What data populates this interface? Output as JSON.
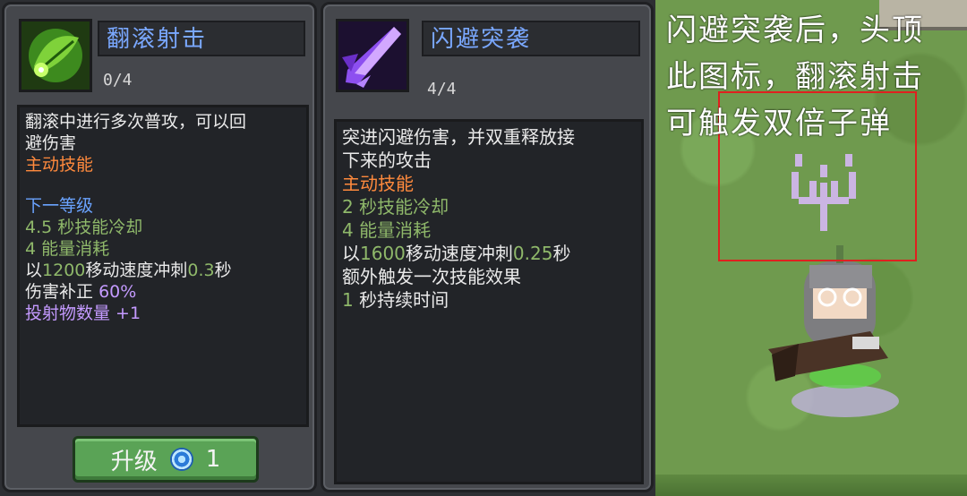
{
  "skill_1": {
    "name": "翻滚射击",
    "level": "0/4",
    "icon": "leaf-skill-icon",
    "desc_lines": [
      "翻滚中进行多次普攻，可以回",
      "避伤害"
    ],
    "type": "主动技能",
    "next_level_header": "下一等级",
    "cooldown": "4.5 秒技能冷却",
    "energy": "4 能量消耗",
    "dash_prefix": "以",
    "dash_speed": "1200",
    "dash_mid": "移动速度冲刺",
    "dash_time": "0.3",
    "dash_suffix": "秒",
    "damage_fix_label": "伤害补正",
    "damage_fix_value": "60%",
    "projectile": "投射物数量 +1",
    "upgrade_label": "升级",
    "upgrade_cost": "1"
  },
  "skill_2": {
    "name": "闪避突袭",
    "level": "4/4",
    "icon": "purple-arrow-skill-icon",
    "desc_lines": [
      "突进闪避伤害，并双重释放接",
      "下来的攻击"
    ],
    "type": "主动技能",
    "cooldown": "2 秒技能冷却",
    "energy": "4 能量消耗",
    "dash_prefix": "以",
    "dash_speed": "1600",
    "dash_mid": "移动速度冲刺",
    "dash_time": "0.25",
    "dash_suffix": "秒",
    "extra": "额外触发一次技能效果",
    "duration_num": "1",
    "duration_text": "秒持续时间"
  },
  "game_caption": "闪避突袭后，头顶此图标，翻滚射击可触发双倍子弹",
  "colors": {
    "orange": "#ff8a3d",
    "blue": "#6aa3ff",
    "green": "#8fb86a",
    "purple": "#c49aff",
    "highlight": "#e0201f"
  }
}
